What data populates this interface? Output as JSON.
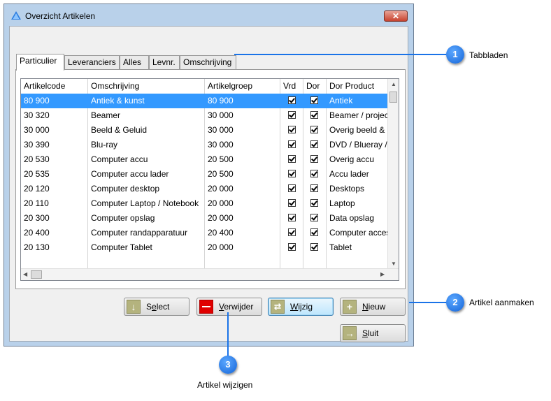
{
  "window": {
    "title": "Overzicht Artikelen",
    "close_label": "✕"
  },
  "tabs": [
    "Particulier",
    "Leveranciers",
    "Alles",
    "Levnr.",
    "Omschrijving"
  ],
  "grid": {
    "headers": [
      "Artikelcode",
      "Omschrijving",
      "Artikelgroep",
      "Vrd",
      "Dor",
      "Dor Product"
    ],
    "rows": [
      {
        "code": "80 900",
        "desc": "Antiek & kunst",
        "group": "80 900",
        "vrd": true,
        "dor": true,
        "product": "Antiek",
        "selected": true
      },
      {
        "code": "30 320",
        "desc": "Beamer",
        "group": "30 000",
        "vrd": true,
        "dor": true,
        "product": "Beamer / projec"
      },
      {
        "code": "30 000",
        "desc": "Beeld & Geluid",
        "group": "30 000",
        "vrd": true,
        "dor": true,
        "product": "Overig beeld & g"
      },
      {
        "code": "30 390",
        "desc": "Blu-ray",
        "group": "30 000",
        "vrd": true,
        "dor": true,
        "product": "DVD / Blueray / C"
      },
      {
        "code": "20 530",
        "desc": "Computer accu",
        "group": "20 500",
        "vrd": true,
        "dor": true,
        "product": "Overig accu"
      },
      {
        "code": "20 535",
        "desc": "Computer accu lader",
        "group": "20 500",
        "vrd": true,
        "dor": true,
        "product": "Accu lader"
      },
      {
        "code": "20 120",
        "desc": "Computer desktop",
        "group": "20 000",
        "vrd": true,
        "dor": true,
        "product": "Desktops"
      },
      {
        "code": "20 110",
        "desc": "Computer Laptop / Notebook",
        "group": "20 000",
        "vrd": true,
        "dor": true,
        "product": "Laptop"
      },
      {
        "code": "20 300",
        "desc": "Computer opslag",
        "group": "20 000",
        "vrd": true,
        "dor": true,
        "product": "Data opslag"
      },
      {
        "code": "20 400",
        "desc": "Computer randapparatuur",
        "group": "20 400",
        "vrd": true,
        "dor": true,
        "product": "Computer acces"
      },
      {
        "code": "20 130",
        "desc": "Computer Tablet",
        "group": "20 000",
        "vrd": true,
        "dor": true,
        "product": "Tablet"
      }
    ]
  },
  "buttons": {
    "select": {
      "pre": "S",
      "u": "e",
      "post": "lect",
      "icon": "arrow-down-icon"
    },
    "verwijder": {
      "pre": "",
      "u": "V",
      "post": "erwijder",
      "icon": "minus-icon"
    },
    "wijzig": {
      "pre": "",
      "u": "W",
      "post": "ijzig",
      "icon": "shuffle-icon"
    },
    "nieuw": {
      "pre": "",
      "u": "N",
      "post": "ieuw",
      "icon": "plus-icon"
    },
    "sluit": {
      "pre": "",
      "u": "S",
      "post": "luit",
      "icon": "arrow-right-icon"
    }
  },
  "callouts": [
    {
      "number": "1",
      "text": "Tabbladen"
    },
    {
      "number": "2",
      "text": "Artikel aanmaken"
    },
    {
      "number": "3",
      "text": "Artikel wijzigen"
    }
  ],
  "colors": {
    "selection": "#3399ff",
    "callout": "#1a73e8",
    "delete_icon": "#e00000",
    "icon_olive": "#b4b37e"
  }
}
